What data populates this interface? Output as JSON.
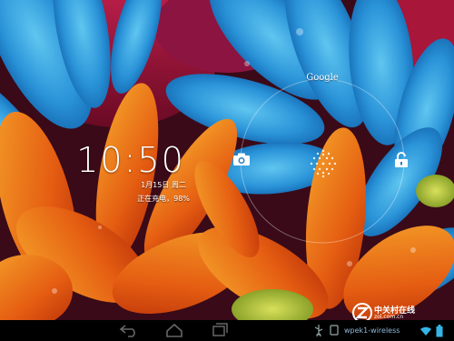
{
  "lockscreen": {
    "time": "10:50",
    "date": "1月15日 周二",
    "charging": "正在充电，98%",
    "google_label": "Google"
  },
  "icons": {
    "camera": "camera-icon",
    "unlock": "unlock-icon",
    "unlock_handle": "unlock-handle-icon"
  },
  "navbar": {
    "notification_text": "wpek1-wireless"
  },
  "watermark": {
    "brand": "中关村在线",
    "url": "zol.com.cn"
  },
  "colors": {
    "blue_petal": "#2d8fd6",
    "orange_petal": "#e8721a",
    "navbar": "#000000",
    "accent": "#33b5e5"
  }
}
